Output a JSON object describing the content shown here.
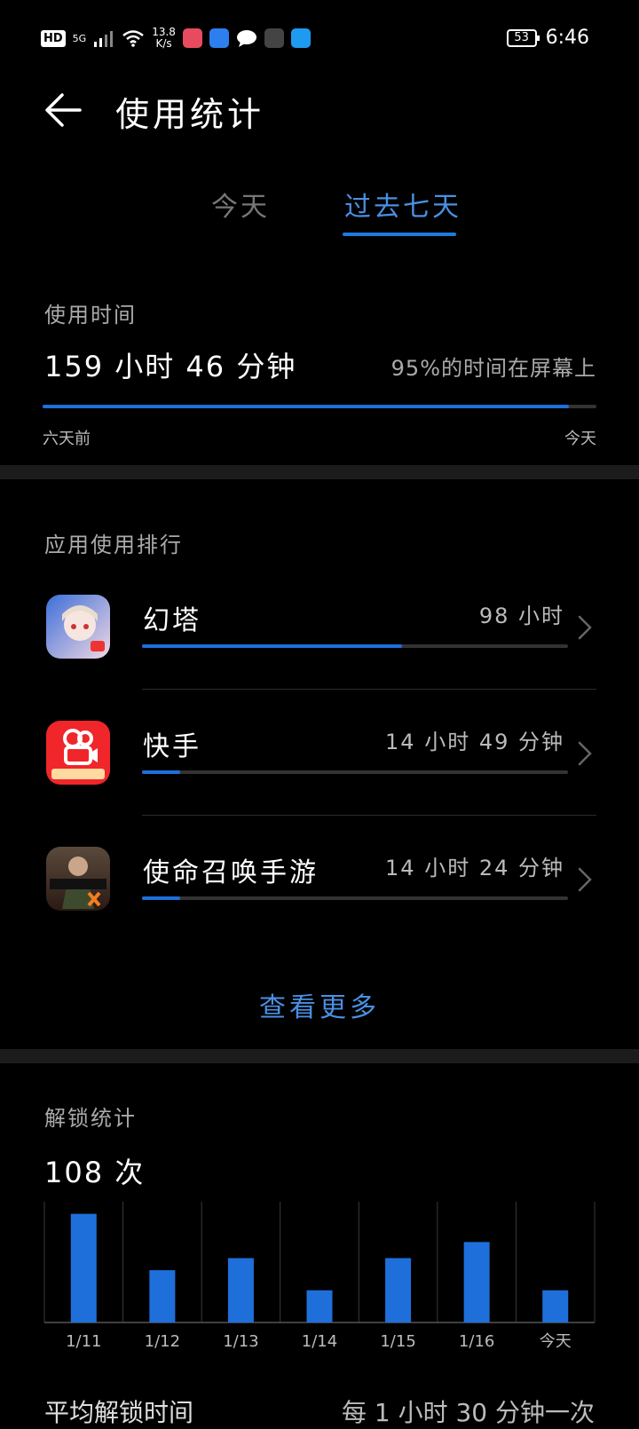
{
  "status_bar": {
    "left_badges": [
      "HD",
      "5G"
    ],
    "net_speed": "13.8",
    "net_speed_unit": "K/s",
    "battery": "53",
    "time": "6:46"
  },
  "header": {
    "title": "使用统计"
  },
  "tabs": [
    {
      "label": "今天",
      "active": false
    },
    {
      "label": "过去七天",
      "active": true
    }
  ],
  "usage": {
    "label": "使用时间",
    "total": "159 小时 46 分钟",
    "percent_text": "95%的时间在屏幕上",
    "fill_percent": 95,
    "range_start": "六天前",
    "range_end": "今天"
  },
  "ranking": {
    "title": "应用使用排行",
    "apps": [
      {
        "name": "幻塔",
        "time": "98 小时",
        "fill_percent": 61,
        "icon": "tower-of-fantasy-icon"
      },
      {
        "name": "快手",
        "time": "14 小时 49 分钟",
        "fill_percent": 9,
        "icon": "kuaishou-icon"
      },
      {
        "name": "使命召唤手游",
        "time": "14 小时 24 分钟",
        "fill_percent": 9,
        "icon": "call-of-duty-icon"
      }
    ],
    "more_label": "查看更多"
  },
  "unlock": {
    "title": "解锁统计",
    "count": "108 次"
  },
  "chart_data": {
    "type": "bar",
    "categories": [
      "1/11",
      "1/12",
      "1/13",
      "1/14",
      "1/15",
      "1/16",
      "今天"
    ],
    "values": [
      27,
      13,
      16,
      8,
      16,
      20,
      8
    ],
    "ylim": [
      0,
      30
    ],
    "grid": true
  },
  "average": {
    "label": "平均解锁时间",
    "value": "每 1 小时 30 分钟一次"
  },
  "colors": {
    "accent": "#1f6fdb",
    "accent_text": "#4a90e2",
    "background": "#000000",
    "divider": "#1c1c1c"
  }
}
